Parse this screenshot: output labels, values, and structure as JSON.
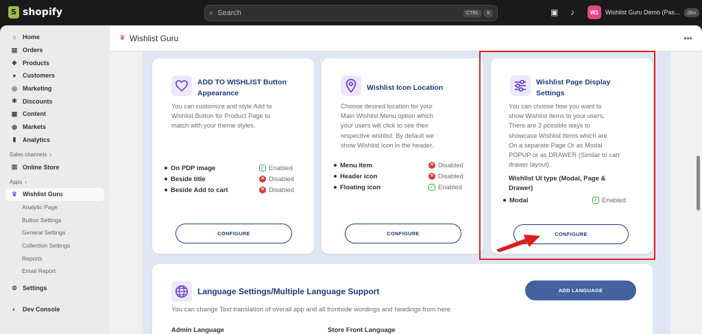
{
  "topbar": {
    "brand": "shopify",
    "search_placeholder": "Search",
    "shortcut_1": "CTRL",
    "shortcut_2": "K",
    "avatar_initials": "W1",
    "store_name": "Wishlist Guru Demo (Pas...",
    "dev_badge": "dev"
  },
  "sidebar": {
    "items": [
      {
        "label": "Home",
        "icon": "home-icon"
      },
      {
        "label": "Orders",
        "icon": "orders-icon"
      },
      {
        "label": "Products",
        "icon": "tag-icon"
      },
      {
        "label": "Customers",
        "icon": "person-icon"
      },
      {
        "label": "Marketing",
        "icon": "target-icon"
      },
      {
        "label": "Discounts",
        "icon": "discount-icon"
      },
      {
        "label": "Content",
        "icon": "content-icon"
      },
      {
        "label": "Markets",
        "icon": "globe-icon"
      },
      {
        "label": "Analytics",
        "icon": "chart-icon"
      }
    ],
    "sales_channels_label": "Sales channels",
    "online_store": "Online Store",
    "apps_label": "Apps",
    "app_name": "Wishlist Guru",
    "app_subitems": [
      "Analytic Page",
      "Button Settings",
      "General Settings",
      "Collection Settings",
      "Reports",
      "Email Report"
    ],
    "settings": "Settings",
    "dev_console": "Dev Console"
  },
  "header": {
    "title": "Wishlist Guru"
  },
  "cards": [
    {
      "title_1": "ADD TO WISHLIST Button",
      "title_2": "Appearance",
      "desc": [
        "You can customize and style Add to",
        "Wishlist Button for Product Page to",
        "match with your theme styles."
      ],
      "features": [
        {
          "label": "On PDP image",
          "status": "Enabled"
        },
        {
          "label": "Beside title",
          "status": "Disabled"
        },
        {
          "label": "Beside Add to cart",
          "status": "Disabled"
        }
      ],
      "button": "CONFIGURE"
    },
    {
      "title_1": "Wishlist Icon Location",
      "desc": [
        "Choose desired location for your",
        "Main Wishlist Menu option which",
        "your users will click to see their",
        "respective wishlist. By default we",
        "show Wishlist Icon in the header."
      ],
      "features": [
        {
          "label": "Menu item",
          "status": "Disabled"
        },
        {
          "label": "Header icon",
          "status": "Disabled"
        },
        {
          "label": "Floating icon",
          "status": "Enabled"
        }
      ],
      "button": "CONFIGURE"
    },
    {
      "title_1": "Wishlist Page Display",
      "title_2": "Settings",
      "desc": [
        "You can choose how you want to",
        "show Wishlist items to your users,",
        "There are 3 possible ways to",
        "showcase Wishlist Items which are",
        "On a separate Page Or as Modal",
        "POPUP or as DRAWER (Similar to cart",
        "drawer layout)."
      ],
      "ui_type_1": "Wishlist UI type (Modal, Page &",
      "ui_type_2": "Drawer)",
      "features": [
        {
          "label": "Modal",
          "status": "Enabled"
        }
      ],
      "button": "CONFIGURE"
    }
  ],
  "language": {
    "title": "Language Settings/Multiple Language Support",
    "desc": "You can change Text translation of overall app and all frontside wordings and headings from here",
    "button": "ADD LANGUAGE",
    "admin_label": "Admin Language",
    "store_label": "Store Front Language"
  },
  "colors": {
    "accent": "#1f3a7a",
    "highlight": "#e01e1e",
    "enabled": "#3aa35a",
    "disabled": "#d93636"
  }
}
